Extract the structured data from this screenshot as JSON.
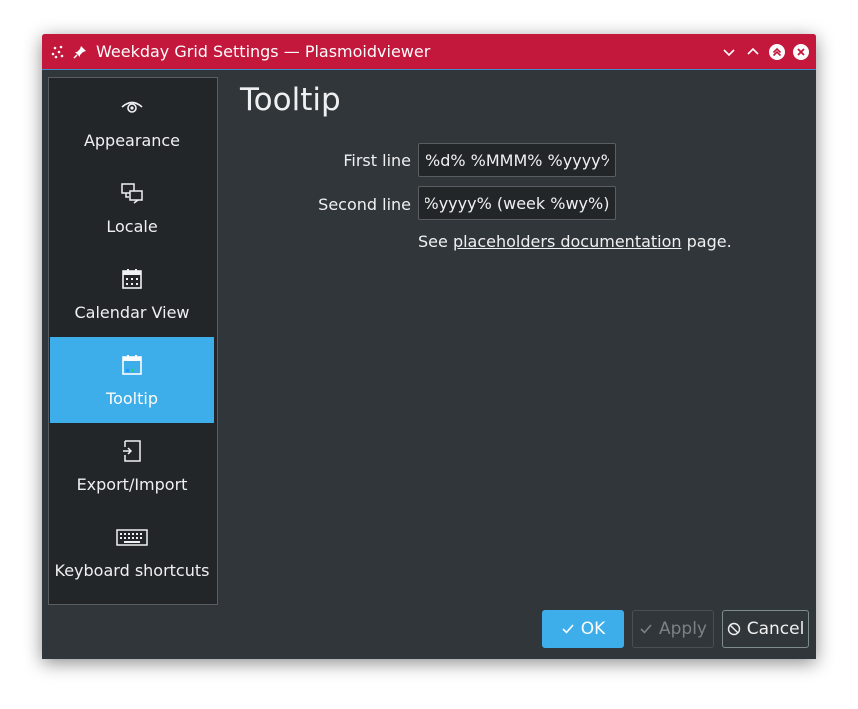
{
  "window": {
    "title": "Weekday Grid Settings — Plasmoidviewer",
    "colors": {
      "titlebar": "#c4173c",
      "background": "#31363b",
      "sidebar": "#232629",
      "accent": "#3daee9"
    }
  },
  "titlebar_buttons": [
    {
      "name": "minimize",
      "icon": "chevron-down-icon"
    },
    {
      "name": "maximize",
      "icon": "chevron-up-icon"
    },
    {
      "name": "keep-above",
      "icon": "double-chevron-up-icon"
    },
    {
      "name": "close",
      "icon": "close-icon"
    }
  ],
  "sidebar": {
    "items": [
      {
        "label": "Appearance",
        "icon": "eye-icon",
        "selected": false
      },
      {
        "label": "Locale",
        "icon": "translate-icon",
        "selected": false
      },
      {
        "label": "Calendar View",
        "icon": "calendar-icon",
        "selected": false
      },
      {
        "label": "Tooltip",
        "icon": "calendar-icon",
        "selected": true
      },
      {
        "label": "Export/Import",
        "icon": "export-icon",
        "selected": false
      },
      {
        "label": "Keyboard shortcuts",
        "icon": "keyboard-icon",
        "selected": false
      }
    ]
  },
  "main": {
    "title": "Tooltip",
    "fields": [
      {
        "label": "First line",
        "value": "%d% %MMM% %yyyy%"
      },
      {
        "label": "Second line",
        "value": "of %yyyy% (week %wy%)"
      }
    ],
    "help": {
      "prefix": "See ",
      "link": "placeholders documentation",
      "suffix": " page."
    }
  },
  "buttons": {
    "ok": "OK",
    "apply": "Apply",
    "cancel": "Cancel"
  }
}
